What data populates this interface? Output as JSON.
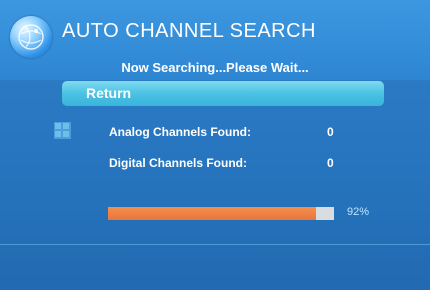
{
  "header": {
    "title": "AUTO CHANNEL SEARCH",
    "logo_icon": "globe-icon"
  },
  "status_text": "Now Searching...Please Wait...",
  "return_button": {
    "label": "Return"
  },
  "results": [
    {
      "label": "Analog Channels Found:",
      "value": "0"
    },
    {
      "label": "Digital Channels Found:",
      "value": "0"
    }
  ],
  "progress": {
    "percent_text": "92%",
    "fraction": 0.92
  },
  "colors": {
    "background": "#2674bd",
    "button": "#4bc2e4",
    "progress_fill": "#e8753a",
    "progress_track": "#d9dde0"
  }
}
